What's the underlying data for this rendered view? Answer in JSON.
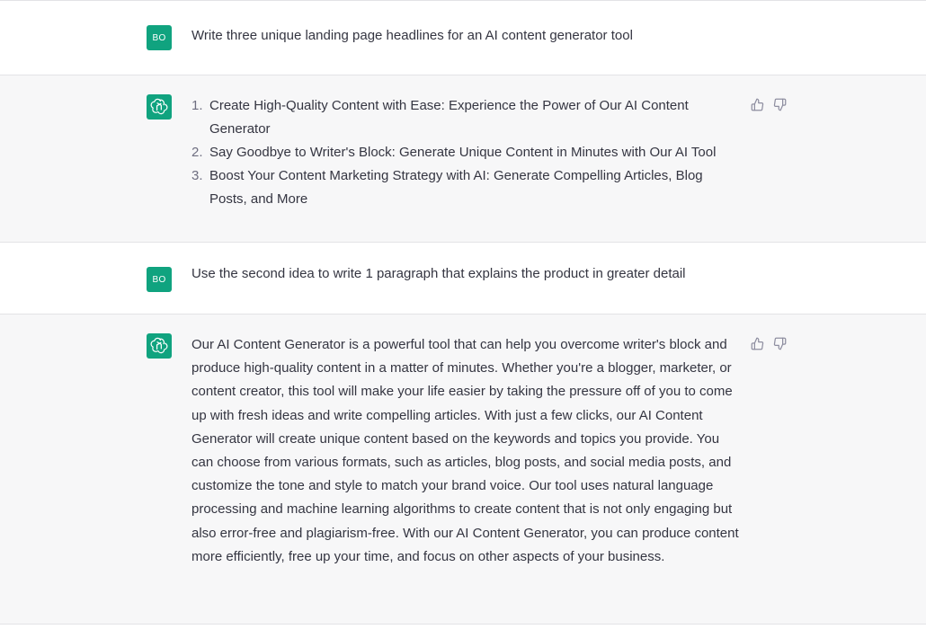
{
  "colors": {
    "accent": "#10a37f",
    "assistant_bg": "#f7f7f8",
    "user_bg": "#ffffff",
    "text": "#343541",
    "muted": "#8e8ea0"
  },
  "messages": [
    {
      "role": "user",
      "avatar": "BO",
      "text": "Write three unique landing page headlines for an AI content generator tool"
    },
    {
      "role": "assistant",
      "avatar_icon": "openai-logo-icon",
      "list": [
        {
          "num": "1.",
          "text": "Create High-Quality Content with Ease: Experience the Power of Our AI Content Generator"
        },
        {
          "num": "2.",
          "text": "Say Goodbye to Writer's Block: Generate Unique Content in Minutes with Our AI Tool"
        },
        {
          "num": "3.",
          "text": "Boost Your Content Marketing Strategy with AI: Generate Compelling Articles, Blog Posts, and More"
        }
      ],
      "feedback_icons": [
        "thumbs-up-icon",
        "thumbs-down-icon"
      ]
    },
    {
      "role": "user",
      "avatar": "BO",
      "text": "Use the second idea to write 1 paragraph that explains the product in greater detail"
    },
    {
      "role": "assistant",
      "avatar_icon": "openai-logo-icon",
      "text": "Our AI Content Generator is a powerful tool that can help you overcome writer's block and produce high-quality content in a matter of minutes. Whether you're a blogger, marketer, or content creator, this tool will make your life easier by taking the pressure off of you to come up with fresh ideas and write compelling articles. With just a few clicks, our AI Content Generator will create unique content based on the keywords and topics you provide. You can choose from various formats, such as articles, blog posts, and social media posts, and customize the tone and style to match your brand voice. Our tool uses natural language processing and machine learning algorithms to create content that is not only engaging but also error-free and plagiarism-free. With our AI Content Generator, you can produce content more efficiently, free up your time, and focus on other aspects of your business.",
      "feedback_icons": [
        "thumbs-up-icon",
        "thumbs-down-icon"
      ]
    }
  ]
}
